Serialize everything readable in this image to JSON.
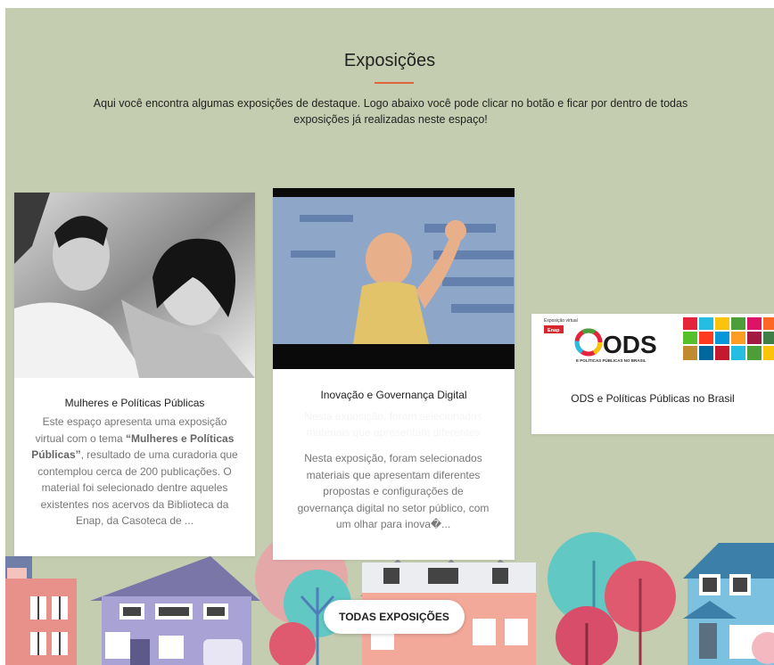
{
  "section": {
    "title": "Exposições",
    "intro": "Aqui você encontra algumas exposições de destaque. Logo abaixo você pode clicar no botão e ficar por dentro de todas exposições já realizadas neste espaço!"
  },
  "cards": [
    {
      "title": "Mulheres e Políticas Públicas",
      "desc_a": "Este espaço apresenta uma exposição virtual com o tema ",
      "desc_bold": "“Mulheres e Políticas Públicas”",
      "desc_b": ", resultado de uma curadoria que contemplou cerca de 200 publicações. O material foi selecionado dentre aqueles existentes nos acervos da Biblioteca da Enap, da Casoteca de ..."
    },
    {
      "title": "Inovação e Governança Digital",
      "ghost": "Nesta exposição, foram selecionados materiais que apresentam diferentes",
      "desc": "Nesta exposição, foram selecionados materiais que apresentam diferentes propostas e configurações de governança digital no setor público, com um olhar para inova�..."
    },
    {
      "title": "ODS e Políticas Públicas no Brasil",
      "banner_small": "Exposição virtual",
      "banner_brand": "Enap",
      "banner_ods": "ODS",
      "banner_sub": "E POLÍTICAS PÚBLICAS NO BRASIL"
    }
  ],
  "button": {
    "label": "TODAS EXPOSIÇÕES"
  },
  "colors": {
    "background": "#c5cdb0",
    "accent": "#e0643a",
    "card": "#ffffff"
  }
}
